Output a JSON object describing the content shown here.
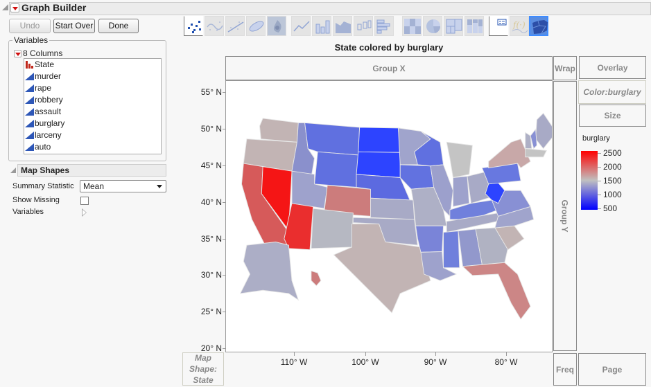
{
  "window": {
    "title": "Graph Builder"
  },
  "buttons": {
    "undo": "Undo",
    "start_over": "Start Over",
    "done": "Done"
  },
  "variables": {
    "legend": "Variables",
    "columns_label": "8 Columns",
    "columns": [
      {
        "name": "State",
        "type": "nominal"
      },
      {
        "name": "murder",
        "type": "continuous"
      },
      {
        "name": "rape",
        "type": "continuous"
      },
      {
        "name": "robbery",
        "type": "continuous"
      },
      {
        "name": "assault",
        "type": "continuous"
      },
      {
        "name": "burglary",
        "type": "continuous"
      },
      {
        "name": "larceny",
        "type": "continuous"
      },
      {
        "name": "auto",
        "type": "continuous"
      }
    ]
  },
  "map_shapes": {
    "title": "Map Shapes",
    "summary_statistic_label": "Summary Statistic",
    "summary_statistic_value": "Mean",
    "show_missing_label": "Show Missing",
    "show_missing_checked": false,
    "variables_label": "Variables"
  },
  "toolbar": {
    "icons": [
      "points-icon",
      "smoother-icon",
      "line-of-fit-icon",
      "ellipse-icon",
      "contour-icon",
      "line-icon",
      "bar-icon",
      "area-icon",
      "box-plot-icon",
      "histogram-icon",
      "heatmap-icon",
      "pie-icon",
      "treemap-icon",
      "mosaic-icon",
      "caption-box-icon",
      "formula-icon",
      "map-shapes-icon"
    ],
    "selected": "map-shapes-icon"
  },
  "graph": {
    "title": "State colored by burglary",
    "zones": {
      "group_x": "Group X",
      "group_y": "Group Y",
      "wrap": "Wrap",
      "overlay": "Overlay",
      "color": "Color:burglary",
      "size": "Size",
      "freq": "Freq",
      "page": "Page",
      "map_shape": "Map Shape: State"
    },
    "y_ticks": [
      "55° N",
      "50° N",
      "45° N",
      "40° N",
      "35° N",
      "30° N",
      "25° N",
      "20° N"
    ],
    "x_ticks": [
      "110° W",
      "100° W",
      "90° W",
      "80° W"
    ],
    "legend": {
      "title": "burglary",
      "ticks": [
        "2500",
        "2000",
        "1500",
        "1000",
        "500"
      ],
      "high_color": "#ff0000",
      "mid_color": "#c0c0c0",
      "low_color": "#0000ff"
    },
    "state_colors": {
      "WA": "#c2b4b4",
      "OR": "#c2b4b4",
      "CA": "#d65a5a",
      "NV": "#f51515",
      "AZ": "#ea2e2e",
      "ID": "#8a90cc",
      "MT": "#6070e0",
      "WY": "#6070e0",
      "UT": "#9ea2cc",
      "CO": "#cc7c7c",
      "NM": "#b6b8c2",
      "ND": "#2d44ff",
      "SD": "#2d44ff",
      "NE": "#5c6ae0",
      "KS": "#a8aac6",
      "OK": "#a8aac6",
      "TX": "#c2b4b4",
      "MN": "#a0a4cc",
      "IA": "#6272e0",
      "MO": "#aeb0c6",
      "AR": "#7a84d8",
      "LA": "#9ea2cc",
      "WI": "#6070e0",
      "IL": "#9ca0cc",
      "MI": "#c4c4c4",
      "IN": "#9ea2cc",
      "OH": "#a8aac6",
      "KY": "#7080dc",
      "TN": "#a8aac6",
      "MS": "#7080dc",
      "AL": "#9298cc",
      "GA": "#b0b2c2",
      "FL": "#cc8686",
      "SC": "#c2b4b4",
      "NC": "#a0a4cc",
      "VA": "#8890d4",
      "WV": "#2d44ff",
      "PA": "#6878e0",
      "NY": "#c8a8a8",
      "ME": "#a8aac6",
      "NH": "#8890d4",
      "VT": "#aeb0c6",
      "MA": "#c4c4c4",
      "AK": "#acaec6",
      "HI": "#cc7c7c"
    }
  }
}
